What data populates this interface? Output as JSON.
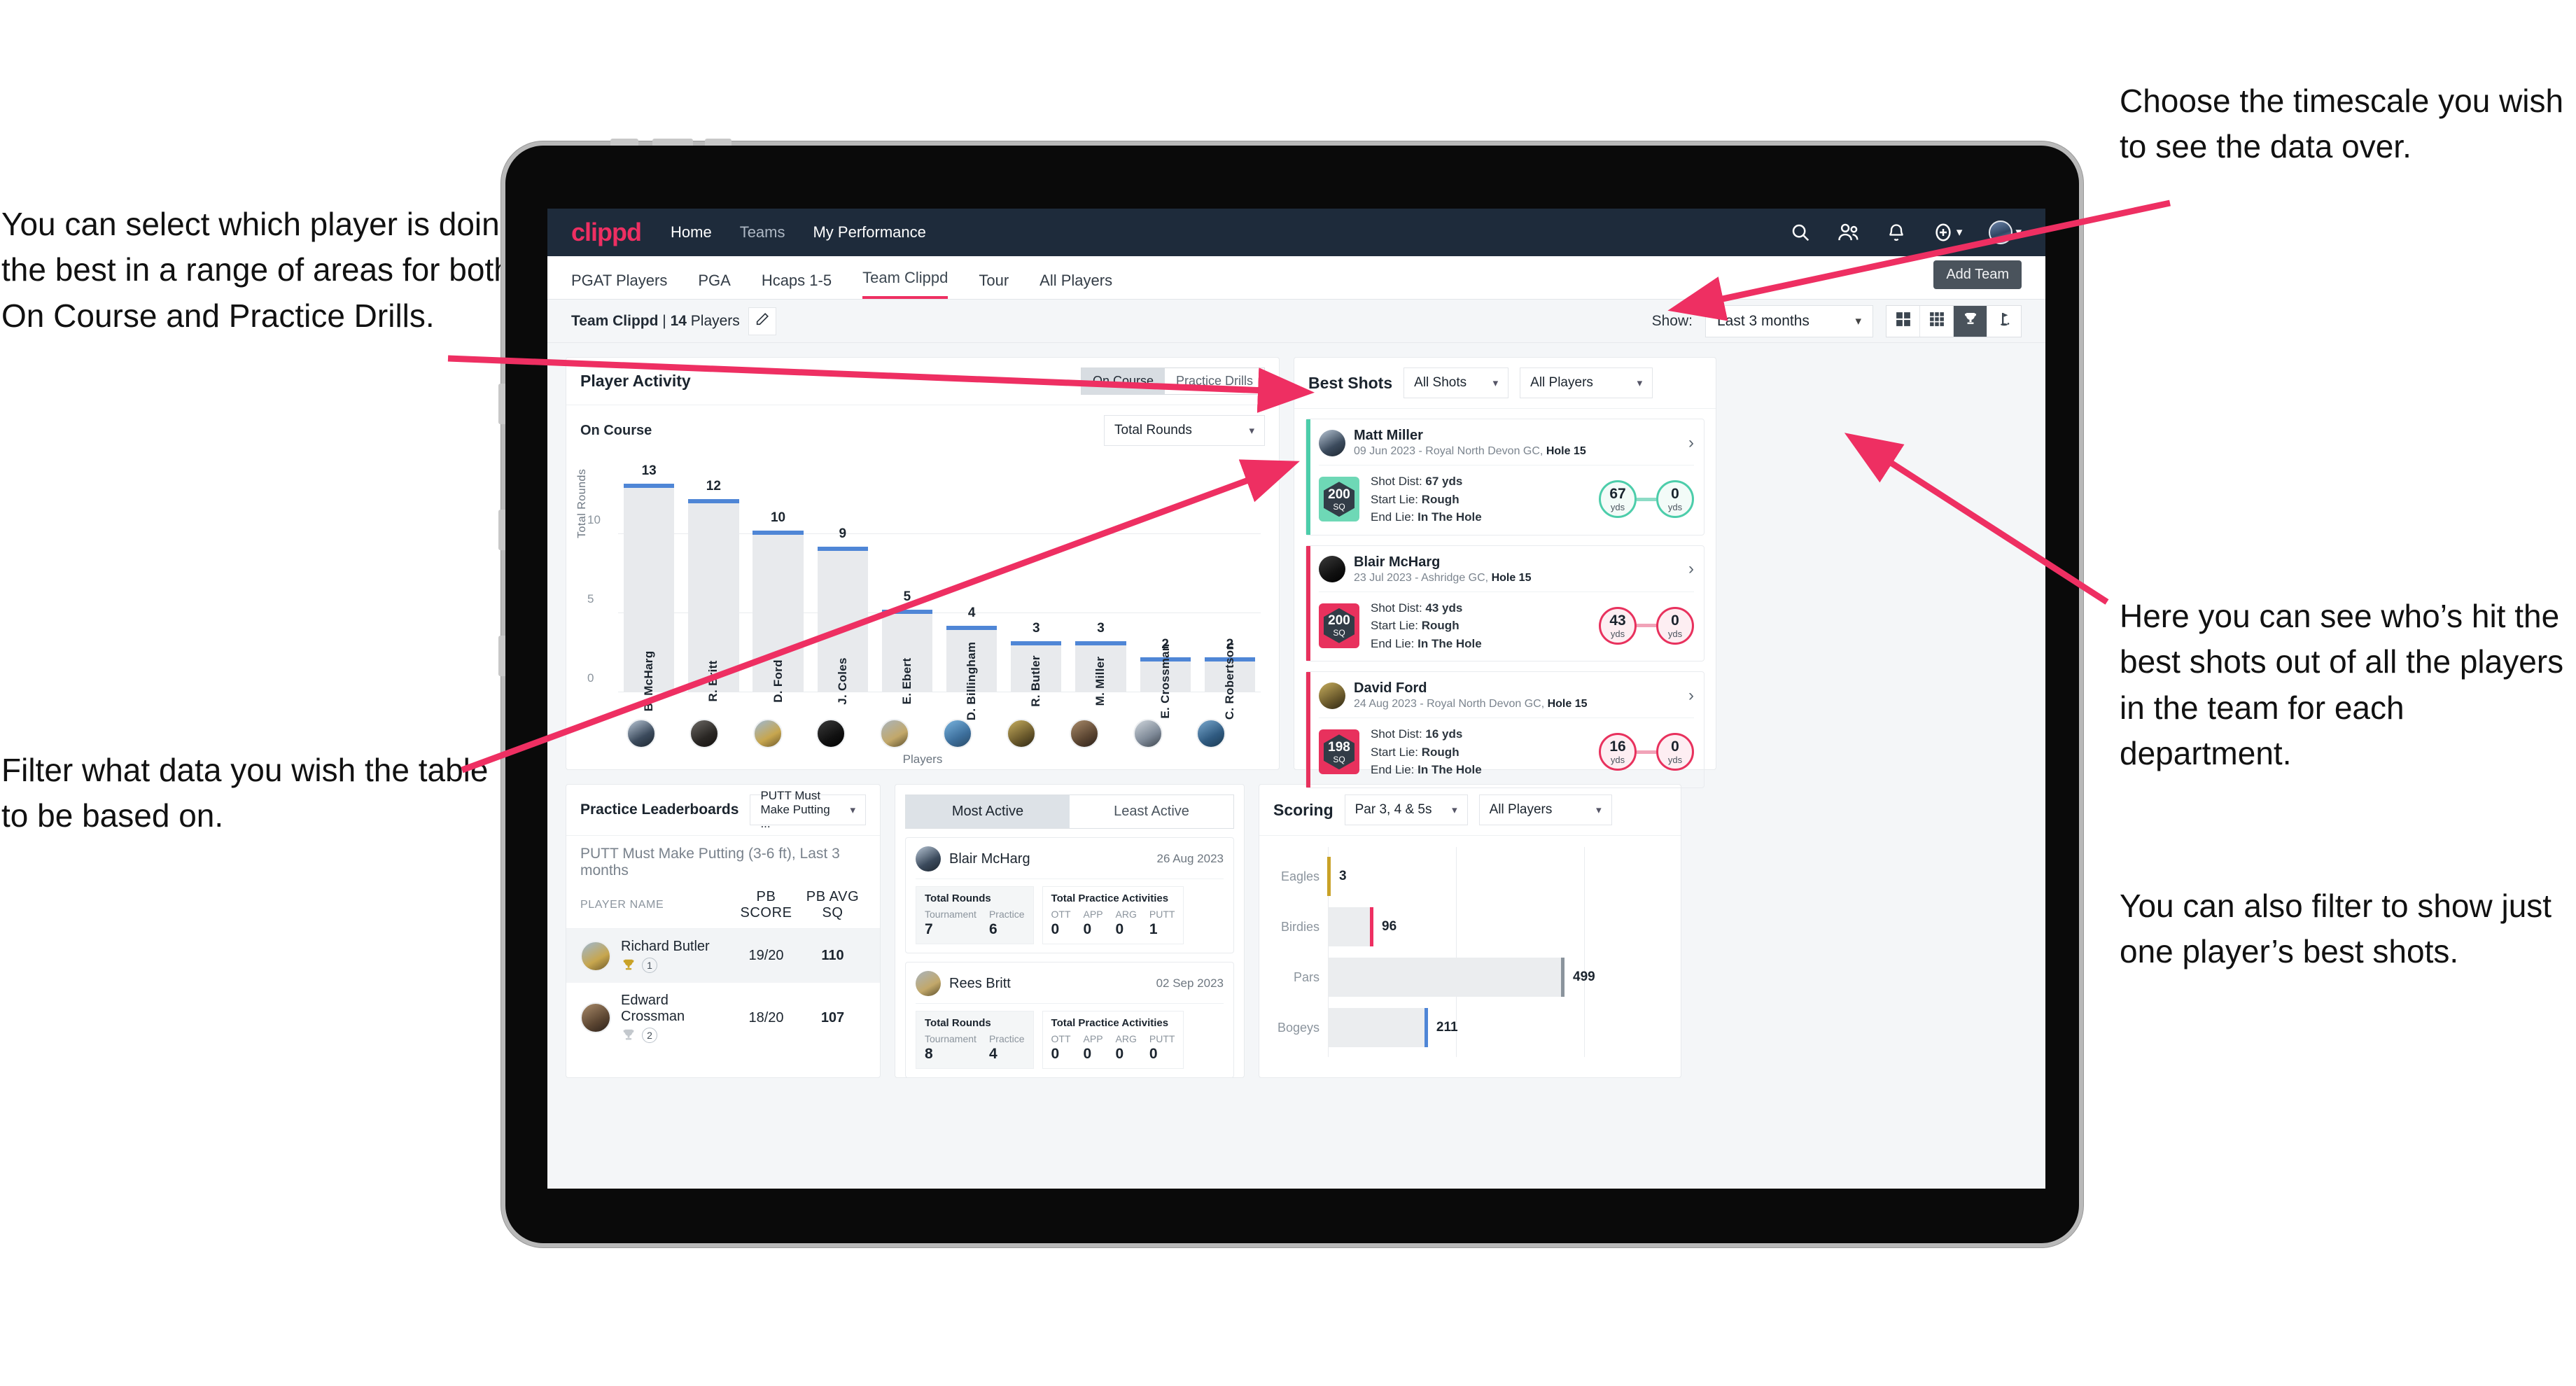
{
  "annotations": {
    "left_top": "You can select which player is doing the best in a range of areas for both On Course and Practice Drills.",
    "left_bottom": "Filter what data you wish the table to be based on.",
    "right_top": "Choose the timescale you wish to see the data over.",
    "right_middle": "Here you can see who’s hit the best shots out of all the players in the team for each department.",
    "right_bottom": "You can also filter to show just one player’s best shots."
  },
  "topnav": {
    "logo": "clippd",
    "links": [
      {
        "label": "Home",
        "active": true
      },
      {
        "label": "Teams",
        "active": false
      },
      {
        "label": "My Performance",
        "active": true
      }
    ],
    "icons": [
      "search-icon",
      "people-icon",
      "bell-icon",
      "plus-circle-icon",
      "avatar"
    ]
  },
  "tabs": [
    {
      "label": "PGAT Players",
      "active": false
    },
    {
      "label": "PGA",
      "active": false
    },
    {
      "label": "Hcaps 1-5",
      "active": false
    },
    {
      "label": "Team Clippd",
      "active": true
    },
    {
      "label": "Tour",
      "active": false
    },
    {
      "label": "All Players",
      "active": false
    }
  ],
  "tooltip": {
    "add_team": "Add Team"
  },
  "toolbar": {
    "team_name": "Team Clippd",
    "separator": " | ",
    "player_count": "14",
    "players_word": "Players",
    "edit_icon": "pencil-icon",
    "show_label": "Show:",
    "timescale_value": "Last 3 months",
    "view_buttons": [
      "grid-2x2-icon",
      "grid-3x3-icon",
      "trophy-icon",
      "golf-flag-icon"
    ],
    "active_view": "trophy-icon"
  },
  "player_activity": {
    "title": "Player Activity",
    "segments": [
      {
        "label": "On Course",
        "active": true
      },
      {
        "label": "Practice Drills",
        "active": false
      }
    ],
    "sub_label": "On Course",
    "metric_select": "Total Rounds",
    "x_axis_caption": "Players"
  },
  "chart_data": {
    "type": "bar",
    "title": "Player Activity",
    "xlabel": "Players",
    "ylabel": "Total Rounds",
    "ylim": [
      0,
      14
    ],
    "yticks": [
      0,
      5,
      10
    ],
    "grid": true,
    "categories": [
      "B. McHarg",
      "R. Britt",
      "D. Ford",
      "J. Coles",
      "E. Ebert",
      "D. Billingham",
      "R. Butler",
      "M. Miller",
      "E. Crossman",
      "C. Robertson"
    ],
    "values": [
      13,
      12,
      10,
      9,
      5,
      4,
      3,
      3,
      2,
      2
    ],
    "bar_color": "#e8eaed",
    "cap_color": "#4f86d6"
  },
  "best_shots": {
    "title": "Best Shots",
    "shot_filter": "All Shots",
    "player_filter": "All Players",
    "cards": [
      {
        "name": "Matt Miller",
        "meta_date": "09 Jun 2023 - Royal North Devon GC,",
        "meta_hole": "Hole 15",
        "badge_value": "200",
        "badge_unit": "SQ",
        "accent": "teal",
        "shot_dist_label": "Shot Dist:",
        "shot_dist_value": "67 yds",
        "start_lie_label": "Start Lie:",
        "start_lie_value": "Rough",
        "end_lie_label": "End Lie:",
        "end_lie_value": "In The Hole",
        "from_value": "67",
        "from_unit": "yds",
        "to_value": "0",
        "to_unit": "yds"
      },
      {
        "name": "Blair McHarg",
        "meta_date": "23 Jul 2023 - Ashridge GC,",
        "meta_hole": "Hole 15",
        "badge_value": "200",
        "badge_unit": "SQ",
        "accent": "pink",
        "shot_dist_label": "Shot Dist:",
        "shot_dist_value": "43 yds",
        "start_lie_label": "Start Lie:",
        "start_lie_value": "Rough",
        "end_lie_label": "End Lie:",
        "end_lie_value": "In The Hole",
        "from_value": "43",
        "from_unit": "yds",
        "to_value": "0",
        "to_unit": "yds"
      },
      {
        "name": "David Ford",
        "meta_date": "24 Aug 2023 - Royal North Devon GC,",
        "meta_hole": "Hole 15",
        "badge_value": "198",
        "badge_unit": "SQ",
        "accent": "pink",
        "shot_dist_label": "Shot Dist:",
        "shot_dist_value": "16 yds",
        "start_lie_label": "Start Lie:",
        "start_lie_value": "Rough",
        "end_lie_label": "End Lie:",
        "end_lie_value": "In The Hole",
        "from_value": "16",
        "from_unit": "yds",
        "to_value": "0",
        "to_unit": "yds"
      }
    ]
  },
  "practice_leaderboards": {
    "title": "Practice Leaderboards",
    "drill_select": "PUTT Must Make Putting ...",
    "subtitle_bold": "PUTT Must Make Putting (3-6 ft),",
    "subtitle_light": "Last 3 months",
    "columns": [
      "PLAYER NAME",
      "PB SCORE",
      "PB AVG SQ"
    ],
    "rows": [
      {
        "name": "Richard Butler",
        "rank": "1",
        "trophy": "gold",
        "pb_score": "19/20",
        "pb_avg_sq": "110",
        "highlight": true
      },
      {
        "name": "Edward Crossman",
        "rank": "2",
        "trophy": "silver",
        "pb_score": "18/20",
        "pb_avg_sq": "107",
        "highlight": false
      }
    ]
  },
  "activity_panel": {
    "tabs": [
      {
        "label": "Most Active",
        "active": true
      },
      {
        "label": "Least Active",
        "active": false
      }
    ],
    "cards": [
      {
        "name": "Blair McHarg",
        "date": "26 Aug 2023",
        "rounds_title": "Total Rounds",
        "rounds": [
          {
            "k": "Tournament",
            "v": "7"
          },
          {
            "k": "Practice",
            "v": "6"
          }
        ],
        "practice_title": "Total Practice Activities",
        "practice": [
          {
            "k": "OTT",
            "v": "0"
          },
          {
            "k": "APP",
            "v": "0"
          },
          {
            "k": "ARG",
            "v": "0"
          },
          {
            "k": "PUTT",
            "v": "1"
          }
        ]
      },
      {
        "name": "Rees Britt",
        "date": "02 Sep 2023",
        "rounds_title": "Total Rounds",
        "rounds": [
          {
            "k": "Tournament",
            "v": "8"
          },
          {
            "k": "Practice",
            "v": "4"
          }
        ],
        "practice_title": "Total Practice Activities",
        "practice": [
          {
            "k": "OTT",
            "v": "0"
          },
          {
            "k": "APP",
            "v": "0"
          },
          {
            "k": "ARG",
            "v": "0"
          },
          {
            "k": "PUTT",
            "v": "0"
          }
        ]
      }
    ]
  },
  "scoring": {
    "title": "Scoring",
    "par_filter": "Par 3, 4 & 5s",
    "player_filter": "All Players",
    "chart": {
      "type": "bar",
      "orientation": "horizontal",
      "categories": [
        "Eagles",
        "Birdies",
        "Pars",
        "Bogeys"
      ],
      "values": [
        3,
        96,
        499,
        211
      ],
      "colors": [
        "#c9a227",
        "#ee2f62",
        "#8b949d",
        "#4f86d6"
      ],
      "xlim": [
        0,
        620
      ],
      "grid": true
    }
  },
  "colors": {
    "brand_pink": "#ee2f62",
    "nav_dark": "#1e2b3b",
    "accent_teal": "#4ccdaa",
    "accent_blue": "#4f86d6"
  }
}
